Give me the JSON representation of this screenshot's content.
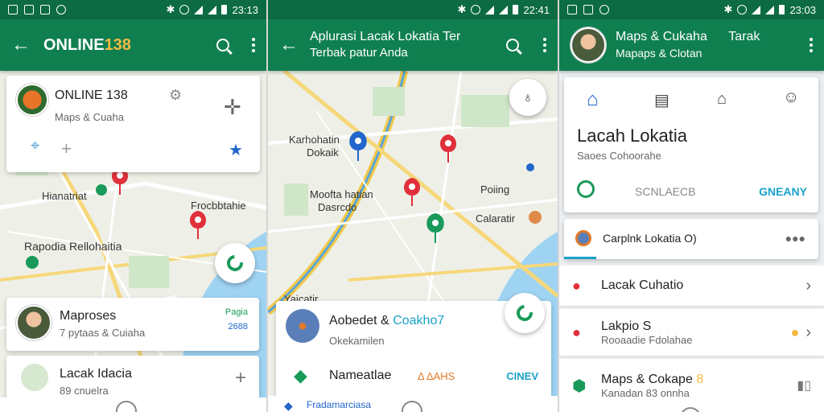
{
  "status": {
    "time1": "23:13",
    "time2": "22:41",
    "time3": "23:03"
  },
  "p1": {
    "title_main": "ONLINE",
    "title_accent": "138",
    "card": {
      "name": "ONLINE 138",
      "sub": "Maps & Cuaha"
    },
    "map_labels": [
      "Hianatriat",
      "Frocbbtahie",
      "Rapodia Rellohaitia"
    ],
    "list": [
      {
        "title": "Maproses",
        "sub": "7 pytaas & Cuiaha",
        "badge_top": "Pagia",
        "badge_bot": "2688"
      },
      {
        "title": "Lacak Idacia",
        "sub": "89 cnuelra"
      }
    ]
  },
  "p2": {
    "title_line1": "Aplurasi Lacak Lokatia Ter",
    "title_line2": "Terbak patur Anda",
    "map_labels": [
      "Karhohatin",
      "Dokaik",
      "Moofta hatian",
      "Dasrcdo",
      "Poiing",
      "Calaratir",
      "Yaicatir..."
    ],
    "sheet": {
      "title": "Aobedet &",
      "title_accent": "Coakho7",
      "sub": "Okekamilen",
      "row_label": "Nameatlae",
      "row_mid": "Δ ΔAHS",
      "row_right": "CINEV"
    },
    "bottom_label": "Fradamarciasa"
  },
  "p3": {
    "title": "Maps & Cukaha",
    "title_right": "Tarak",
    "subtitle": "Mapaps & Clotan",
    "card_title": "Lacah Lokatia",
    "card_sub": "Saoes Cohoorahe",
    "action_mid": "SCNLAECB",
    "action_right": "GNEANY",
    "search_text": "Carplnk Lokatia O)",
    "list": [
      {
        "title": "Lacak Cuhatio",
        "sub": ""
      },
      {
        "title": "Lakpio S",
        "sub": "Rooaadie Fdolahae"
      },
      {
        "title": "Maps & Cokape",
        "title_accent": "8",
        "sub": "Kanadan 83 onnha"
      }
    ]
  },
  "colors": {
    "primary": "#0f7f50",
    "status": "#0c6b43",
    "accent": "#f4b942",
    "pin": "#e0303a",
    "blue_pin": "#2266cc"
  }
}
